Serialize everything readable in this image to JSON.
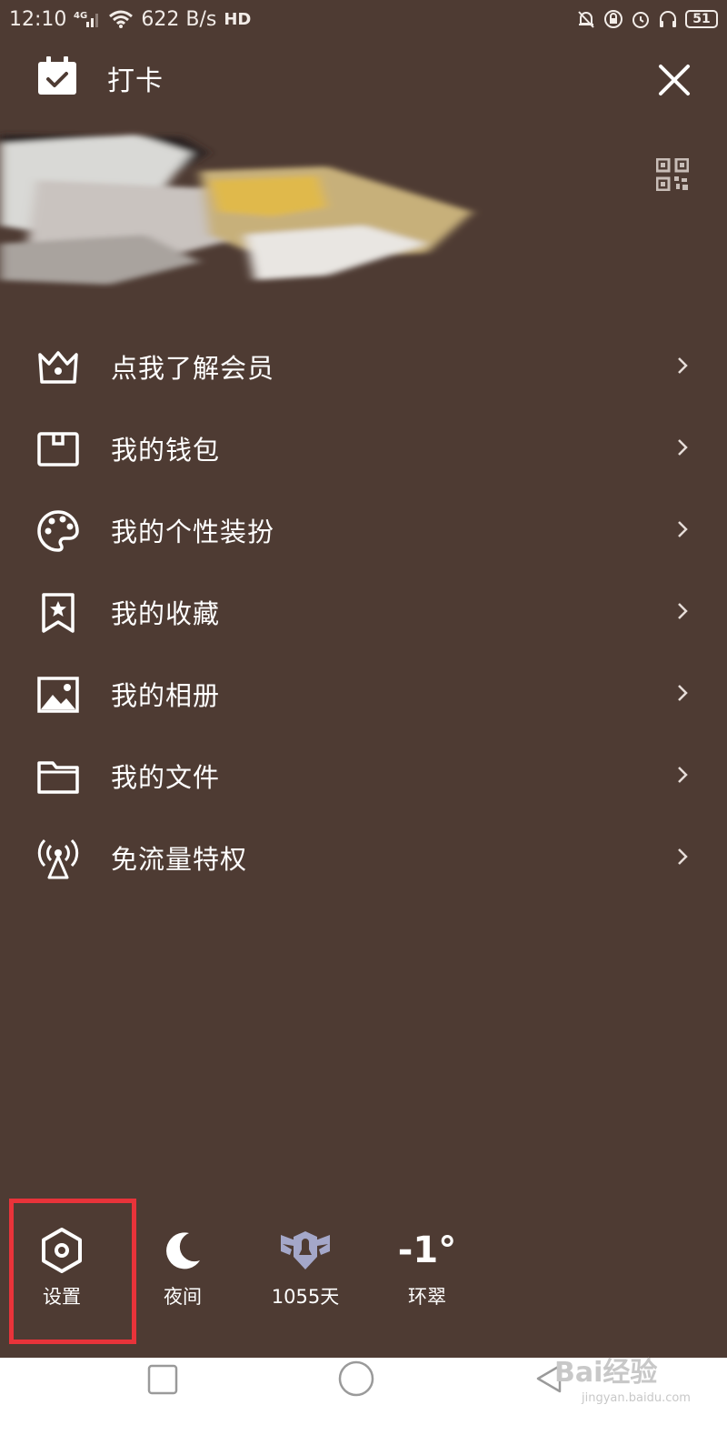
{
  "status_bar": {
    "time": "12:10",
    "network": "4G",
    "speed": "622 B/s",
    "hd": "HD",
    "battery": "51"
  },
  "header": {
    "checkin_label": "打卡"
  },
  "menu": {
    "items": [
      {
        "label": "点我了解会员",
        "icon": "crown-icon"
      },
      {
        "label": "我的钱包",
        "icon": "wallet-icon"
      },
      {
        "label": "我的个性装扮",
        "icon": "palette-icon"
      },
      {
        "label": "我的收藏",
        "icon": "bookmark-star-icon"
      },
      {
        "label": "我的相册",
        "icon": "photo-icon"
      },
      {
        "label": "我的文件",
        "icon": "folder-icon"
      },
      {
        "label": "免流量特权",
        "icon": "signal-tower-icon"
      }
    ]
  },
  "bottom_bar": {
    "settings_label": "设置",
    "night_label": "夜间",
    "days_label": "1055天",
    "temperature": "-1°",
    "city": "环翠"
  },
  "watermark": {
    "text": "Bai经验",
    "url": "jingyan.baidu.com"
  },
  "colors": {
    "background": "#4e3b33",
    "highlight": "#e8333a",
    "nav_bar": "#ffffff"
  }
}
